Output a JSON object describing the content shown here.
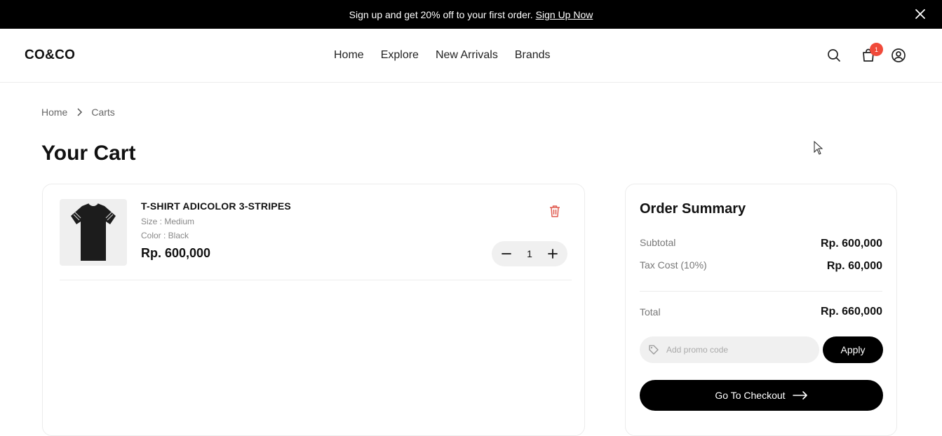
{
  "promo_bar": {
    "text": "Sign up and get 20% off to your first order.",
    "link": "Sign Up Now"
  },
  "header": {
    "logo": "CO&CO",
    "nav": [
      "Home",
      "Explore",
      "New Arrivals",
      "Brands"
    ],
    "cart_count": "1",
    "icons": [
      "search-icon",
      "shopping-bag-icon",
      "user-icon"
    ],
    "badge_color": "#f04a3a"
  },
  "breadcrumb": [
    "Home",
    "Carts"
  ],
  "page_title": "Your Cart",
  "cart": {
    "items": [
      {
        "name": "T-SHIRT ADICOLOR 3-STRIPES",
        "size": "Size : Medium",
        "color": "Color : Black",
        "price": "Rp. 600,000",
        "quantity": "1"
      }
    ]
  },
  "summary": {
    "title": "Order Summary",
    "subtotal_label": "Subtotal",
    "subtotal_value": "Rp. 600,000",
    "tax_label": "Tax Cost (10%)",
    "tax_value": "Rp. 60,000",
    "total_label": "Total",
    "total_value": "Rp. 660,000",
    "promo_placeholder": "Add promo code",
    "apply_label": "Apply",
    "checkout_label": "Go To Checkout"
  },
  "colors": {
    "accent": "#000000",
    "danger": "#e05a4f"
  }
}
